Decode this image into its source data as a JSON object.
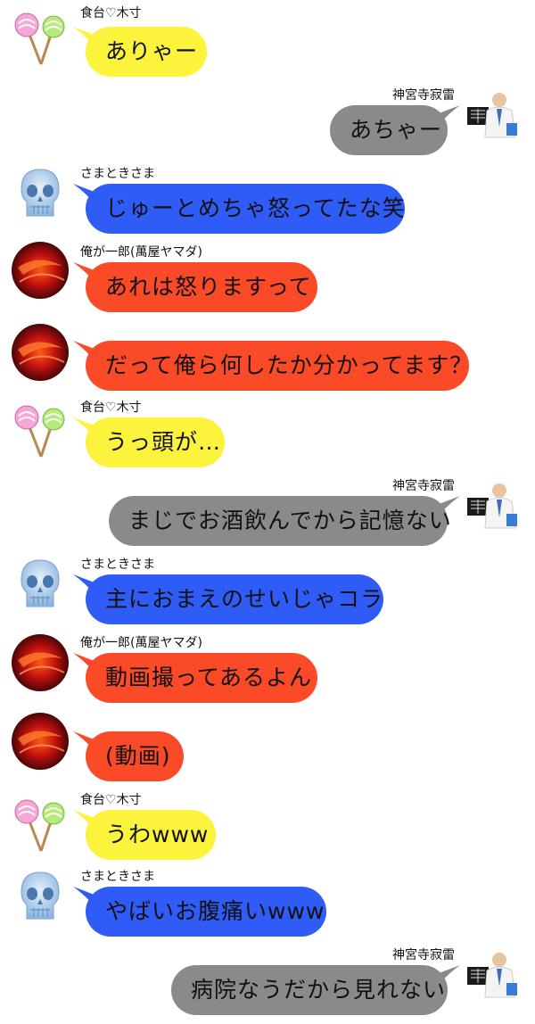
{
  "chat": {
    "speakers": {
      "lollipop": "食台♡木寸",
      "doctor": "神宮寺寂雷",
      "skull": "さまときさま",
      "red": "俺が一郎(萬屋ヤマダ)"
    },
    "messages": [
      {
        "text": "ありゃー"
      },
      {
        "text": "あちゃー"
      },
      {
        "text": "じゅーとめちゃ怒ってたな笑"
      },
      {
        "text": "あれは怒りますって"
      },
      {
        "text": "だって俺ら何したか分かってます？"
      },
      {
        "text": "うっ頭が…"
      },
      {
        "text": "まじでお酒飲んでから記憶ない"
      },
      {
        "text": "主におまえのせいじゃコラ"
      },
      {
        "text": "動画撮ってあるよん"
      },
      {
        "text": "(動画)"
      },
      {
        "text": "うわwww"
      },
      {
        "text": "やばいお腹痛いwww"
      },
      {
        "text": "病院なうだから見れない"
      }
    ]
  },
  "colors": {
    "lollipop_bubble": "#fcf33c",
    "skull_bubble": "#2f5cf7",
    "red_bubble": "#fa4a27",
    "doctor_bubble": "#8a8a8a"
  },
  "icons": {
    "lollipop": "lollipops-icon",
    "doctor": "doctor-xray-icon",
    "skull": "blue-skull-icon",
    "red": "red-abstract-icon"
  }
}
